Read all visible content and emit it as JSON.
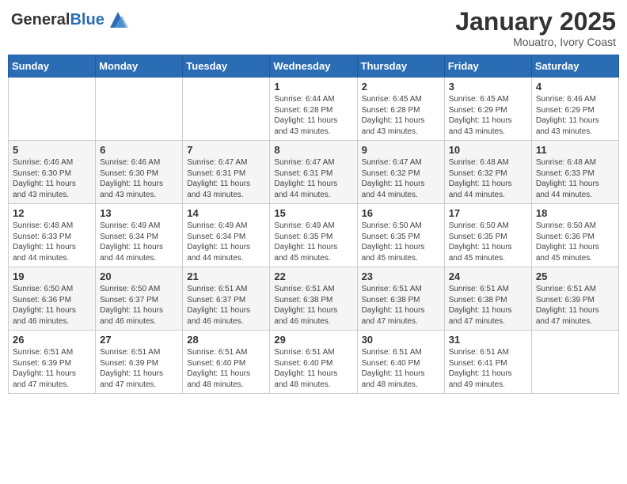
{
  "header": {
    "logo_general": "General",
    "logo_blue": "Blue",
    "month_title": "January 2025",
    "location": "Mouatro, Ivory Coast"
  },
  "days_of_week": [
    "Sunday",
    "Monday",
    "Tuesday",
    "Wednesday",
    "Thursday",
    "Friday",
    "Saturday"
  ],
  "weeks": [
    [
      {
        "day": "",
        "sunrise": "",
        "sunset": "",
        "daylight": ""
      },
      {
        "day": "",
        "sunrise": "",
        "sunset": "",
        "daylight": ""
      },
      {
        "day": "",
        "sunrise": "",
        "sunset": "",
        "daylight": ""
      },
      {
        "day": "1",
        "sunrise": "Sunrise: 6:44 AM",
        "sunset": "Sunset: 6:28 PM",
        "daylight": "Daylight: 11 hours and 43 minutes."
      },
      {
        "day": "2",
        "sunrise": "Sunrise: 6:45 AM",
        "sunset": "Sunset: 6:28 PM",
        "daylight": "Daylight: 11 hours and 43 minutes."
      },
      {
        "day": "3",
        "sunrise": "Sunrise: 6:45 AM",
        "sunset": "Sunset: 6:29 PM",
        "daylight": "Daylight: 11 hours and 43 minutes."
      },
      {
        "day": "4",
        "sunrise": "Sunrise: 6:46 AM",
        "sunset": "Sunset: 6:29 PM",
        "daylight": "Daylight: 11 hours and 43 minutes."
      }
    ],
    [
      {
        "day": "5",
        "sunrise": "Sunrise: 6:46 AM",
        "sunset": "Sunset: 6:30 PM",
        "daylight": "Daylight: 11 hours and 43 minutes."
      },
      {
        "day": "6",
        "sunrise": "Sunrise: 6:46 AM",
        "sunset": "Sunset: 6:30 PM",
        "daylight": "Daylight: 11 hours and 43 minutes."
      },
      {
        "day": "7",
        "sunrise": "Sunrise: 6:47 AM",
        "sunset": "Sunset: 6:31 PM",
        "daylight": "Daylight: 11 hours and 43 minutes."
      },
      {
        "day": "8",
        "sunrise": "Sunrise: 6:47 AM",
        "sunset": "Sunset: 6:31 PM",
        "daylight": "Daylight: 11 hours and 44 minutes."
      },
      {
        "day": "9",
        "sunrise": "Sunrise: 6:47 AM",
        "sunset": "Sunset: 6:32 PM",
        "daylight": "Daylight: 11 hours and 44 minutes."
      },
      {
        "day": "10",
        "sunrise": "Sunrise: 6:48 AM",
        "sunset": "Sunset: 6:32 PM",
        "daylight": "Daylight: 11 hours and 44 minutes."
      },
      {
        "day": "11",
        "sunrise": "Sunrise: 6:48 AM",
        "sunset": "Sunset: 6:33 PM",
        "daylight": "Daylight: 11 hours and 44 minutes."
      }
    ],
    [
      {
        "day": "12",
        "sunrise": "Sunrise: 6:48 AM",
        "sunset": "Sunset: 6:33 PM",
        "daylight": "Daylight: 11 hours and 44 minutes."
      },
      {
        "day": "13",
        "sunrise": "Sunrise: 6:49 AM",
        "sunset": "Sunset: 6:34 PM",
        "daylight": "Daylight: 11 hours and 44 minutes."
      },
      {
        "day": "14",
        "sunrise": "Sunrise: 6:49 AM",
        "sunset": "Sunset: 6:34 PM",
        "daylight": "Daylight: 11 hours and 44 minutes."
      },
      {
        "day": "15",
        "sunrise": "Sunrise: 6:49 AM",
        "sunset": "Sunset: 6:35 PM",
        "daylight": "Daylight: 11 hours and 45 minutes."
      },
      {
        "day": "16",
        "sunrise": "Sunrise: 6:50 AM",
        "sunset": "Sunset: 6:35 PM",
        "daylight": "Daylight: 11 hours and 45 minutes."
      },
      {
        "day": "17",
        "sunrise": "Sunrise: 6:50 AM",
        "sunset": "Sunset: 6:35 PM",
        "daylight": "Daylight: 11 hours and 45 minutes."
      },
      {
        "day": "18",
        "sunrise": "Sunrise: 6:50 AM",
        "sunset": "Sunset: 6:36 PM",
        "daylight": "Daylight: 11 hours and 45 minutes."
      }
    ],
    [
      {
        "day": "19",
        "sunrise": "Sunrise: 6:50 AM",
        "sunset": "Sunset: 6:36 PM",
        "daylight": "Daylight: 11 hours and 46 minutes."
      },
      {
        "day": "20",
        "sunrise": "Sunrise: 6:50 AM",
        "sunset": "Sunset: 6:37 PM",
        "daylight": "Daylight: 11 hours and 46 minutes."
      },
      {
        "day": "21",
        "sunrise": "Sunrise: 6:51 AM",
        "sunset": "Sunset: 6:37 PM",
        "daylight": "Daylight: 11 hours and 46 minutes."
      },
      {
        "day": "22",
        "sunrise": "Sunrise: 6:51 AM",
        "sunset": "Sunset: 6:38 PM",
        "daylight": "Daylight: 11 hours and 46 minutes."
      },
      {
        "day": "23",
        "sunrise": "Sunrise: 6:51 AM",
        "sunset": "Sunset: 6:38 PM",
        "daylight": "Daylight: 11 hours and 47 minutes."
      },
      {
        "day": "24",
        "sunrise": "Sunrise: 6:51 AM",
        "sunset": "Sunset: 6:38 PM",
        "daylight": "Daylight: 11 hours and 47 minutes."
      },
      {
        "day": "25",
        "sunrise": "Sunrise: 6:51 AM",
        "sunset": "Sunset: 6:39 PM",
        "daylight": "Daylight: 11 hours and 47 minutes."
      }
    ],
    [
      {
        "day": "26",
        "sunrise": "Sunrise: 6:51 AM",
        "sunset": "Sunset: 6:39 PM",
        "daylight": "Daylight: 11 hours and 47 minutes."
      },
      {
        "day": "27",
        "sunrise": "Sunrise: 6:51 AM",
        "sunset": "Sunset: 6:39 PM",
        "daylight": "Daylight: 11 hours and 47 minutes."
      },
      {
        "day": "28",
        "sunrise": "Sunrise: 6:51 AM",
        "sunset": "Sunset: 6:40 PM",
        "daylight": "Daylight: 11 hours and 48 minutes."
      },
      {
        "day": "29",
        "sunrise": "Sunrise: 6:51 AM",
        "sunset": "Sunset: 6:40 PM",
        "daylight": "Daylight: 11 hours and 48 minutes."
      },
      {
        "day": "30",
        "sunrise": "Sunrise: 6:51 AM",
        "sunset": "Sunset: 6:40 PM",
        "daylight": "Daylight: 11 hours and 48 minutes."
      },
      {
        "day": "31",
        "sunrise": "Sunrise: 6:51 AM",
        "sunset": "Sunset: 6:41 PM",
        "daylight": "Daylight: 11 hours and 49 minutes."
      },
      {
        "day": "",
        "sunrise": "",
        "sunset": "",
        "daylight": ""
      }
    ]
  ]
}
